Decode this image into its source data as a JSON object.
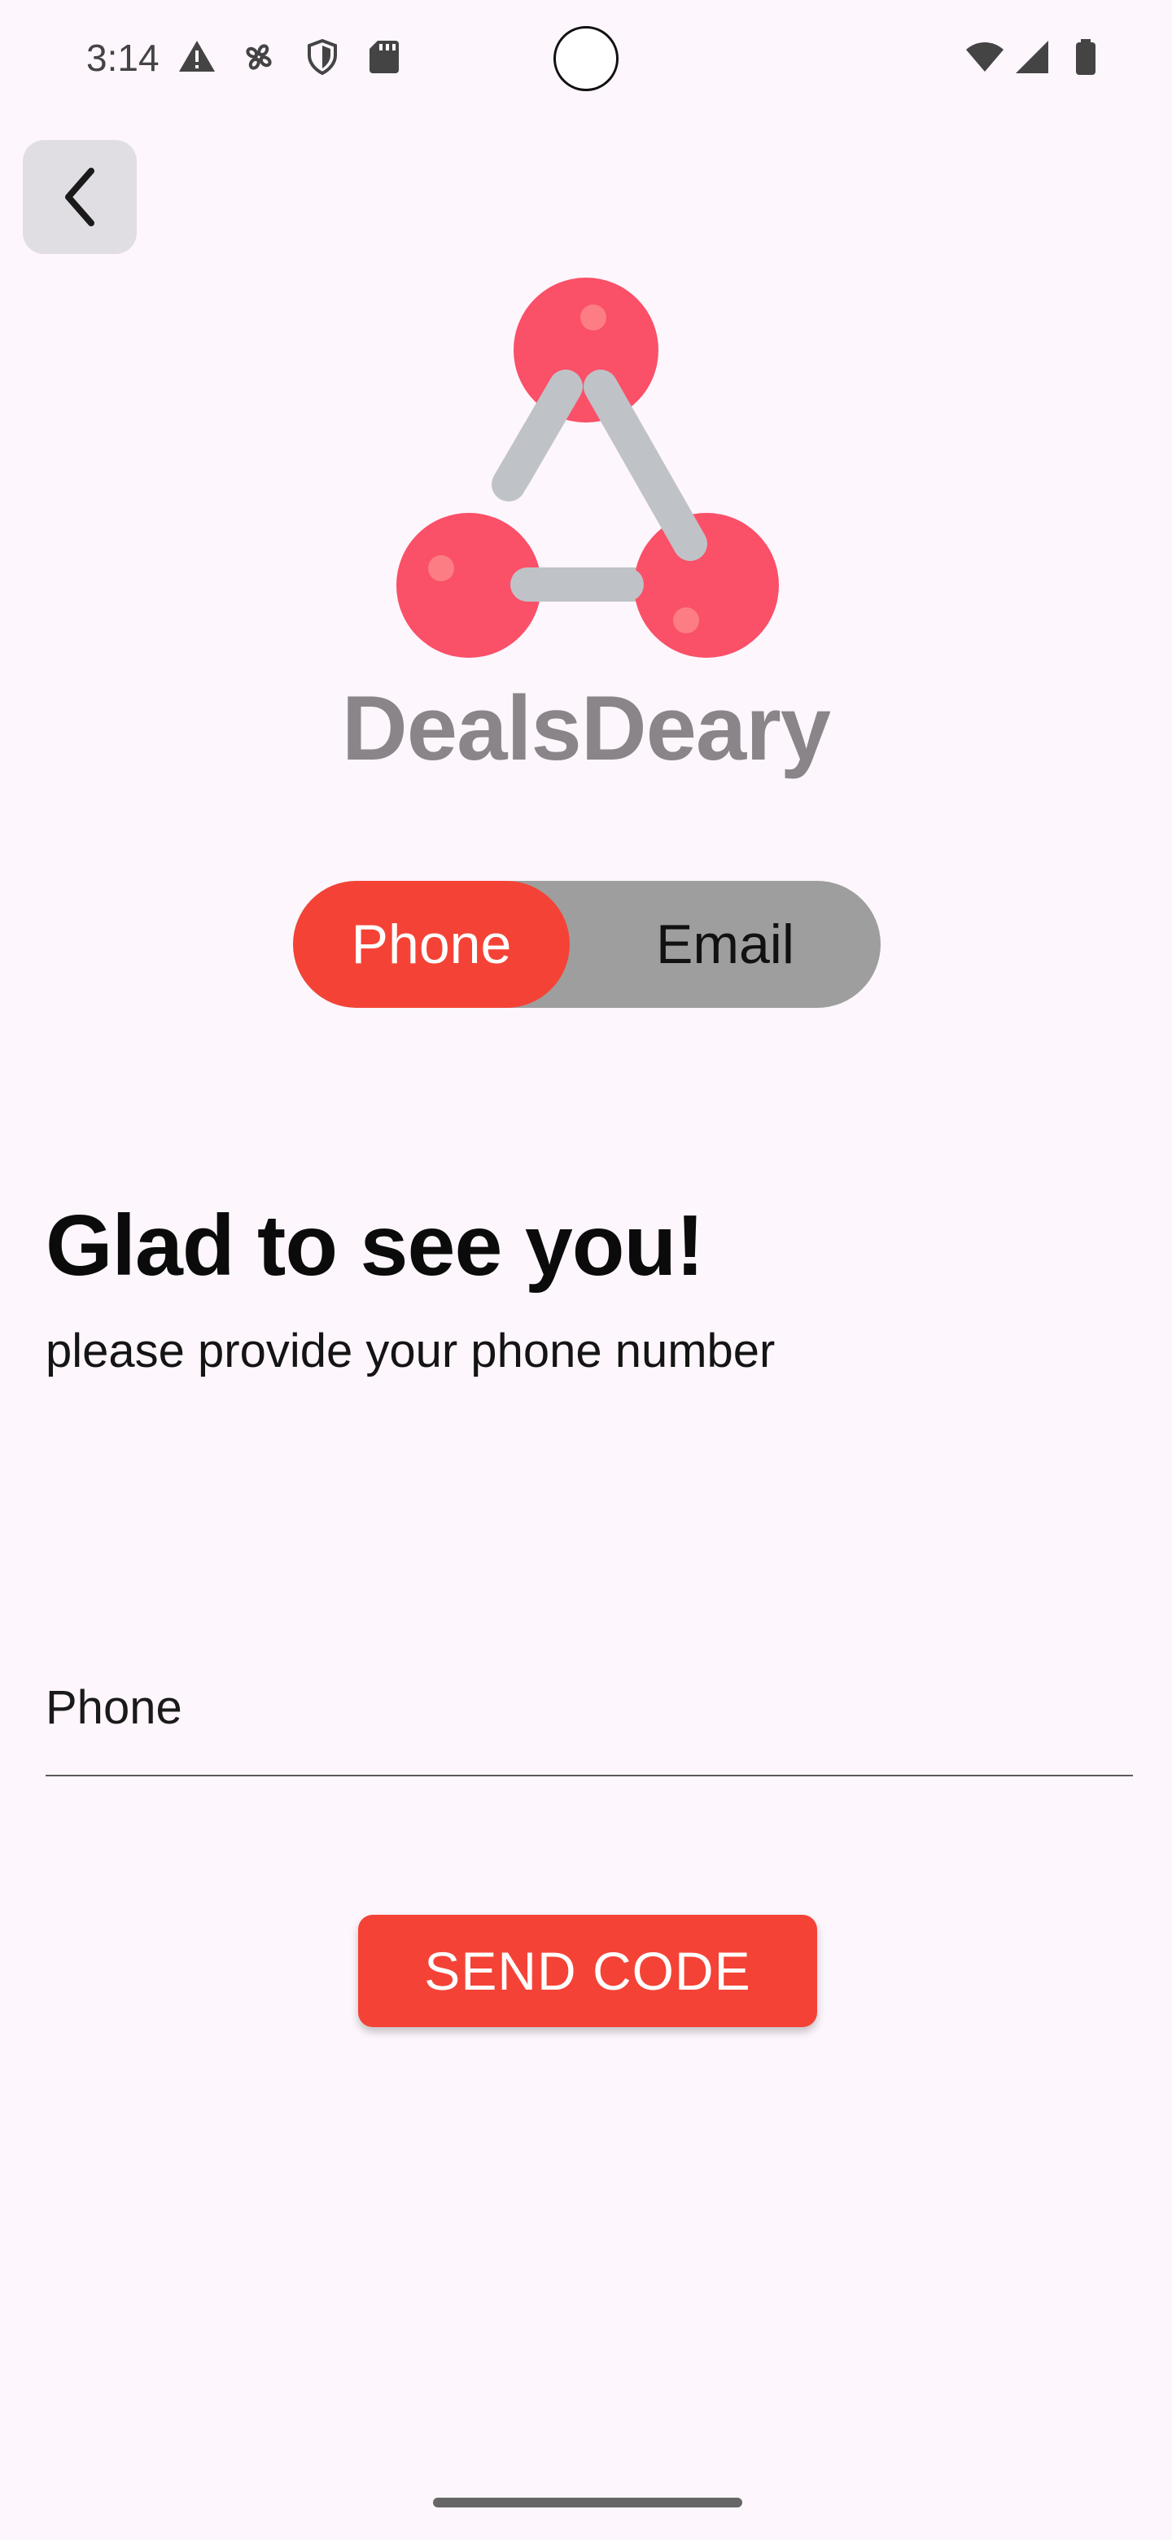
{
  "status_bar": {
    "time": "3:14",
    "left_icons": [
      "warning-icon",
      "fan-icon",
      "shield-icon",
      "sd-card-icon"
    ],
    "right_icons": [
      "wifi-icon",
      "signal-icon",
      "battery-icon"
    ]
  },
  "nav": {
    "back_icon": "chevron-left-icon"
  },
  "brand": {
    "name": "DealsDeary",
    "colors": {
      "node": "#FA5068",
      "link": "#BFC3C7",
      "text": "#8A8589"
    }
  },
  "mode_toggle": {
    "options": [
      "Phone",
      "Email"
    ],
    "selected": "Phone",
    "colors": {
      "selected_bg": "#F44336",
      "track_bg": "#9E9E9E"
    }
  },
  "heading": "Glad to see you!",
  "subheading": "please provide your phone number",
  "phone_field": {
    "label": "Phone",
    "value": ""
  },
  "send_button": {
    "label": "SEND CODE",
    "color": "#F44336"
  },
  "colors": {
    "background": "#FDF6FC",
    "accent": "#F44336"
  }
}
